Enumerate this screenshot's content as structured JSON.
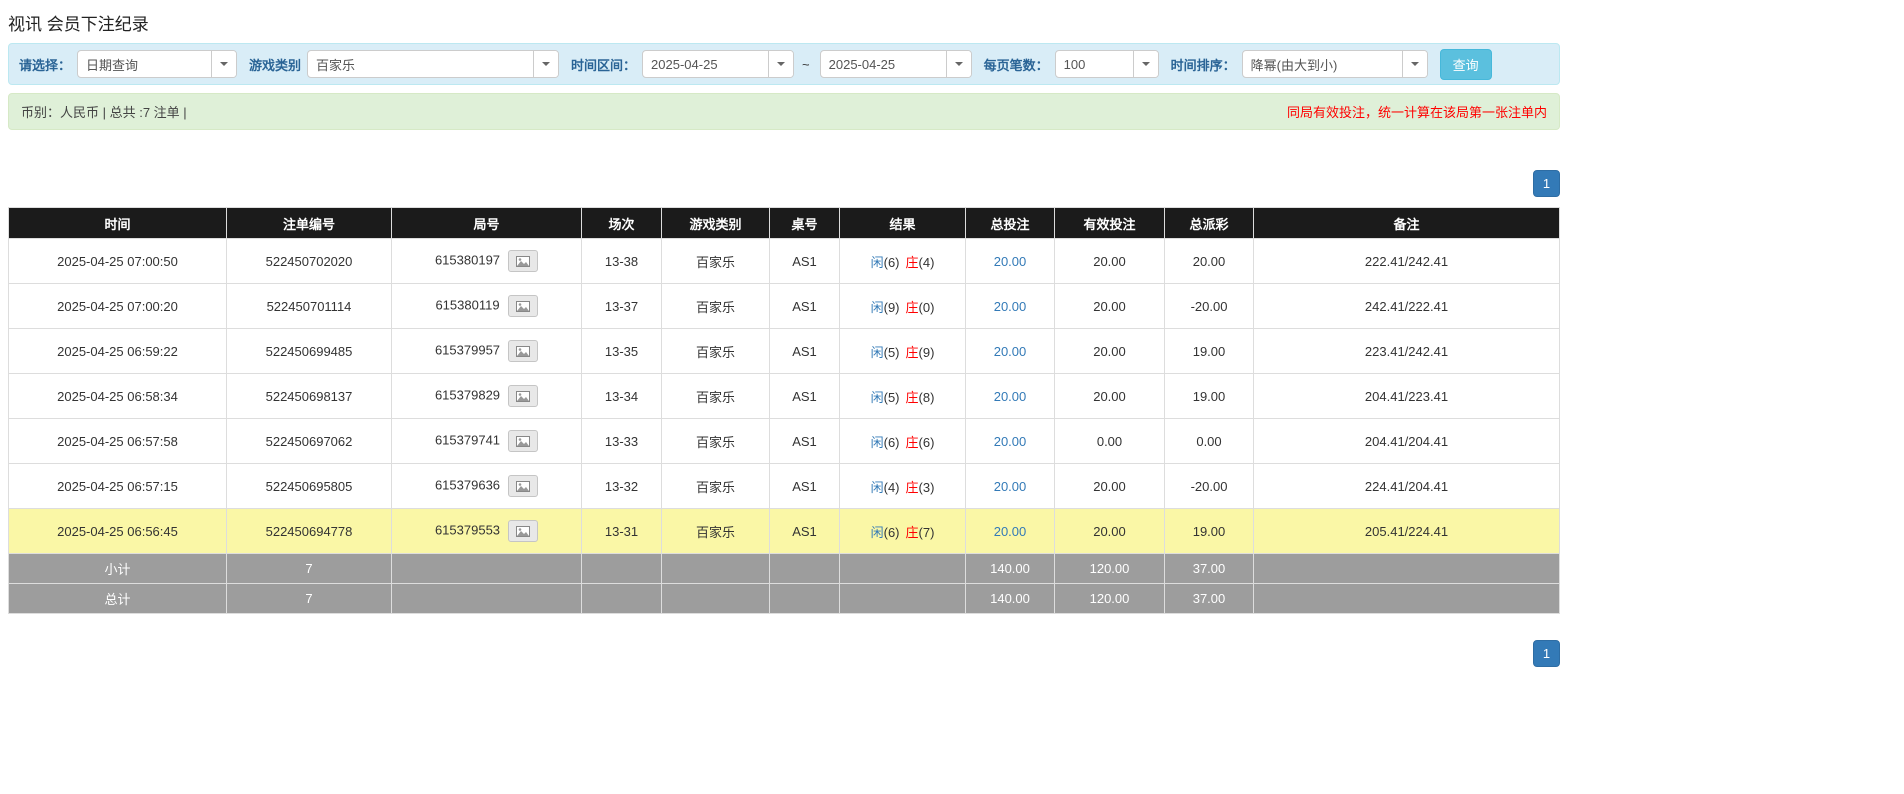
{
  "page_title": "视讯 会员下注纪录",
  "filter_bar": {
    "select_label": "请选择：",
    "select_value": "日期查询",
    "game_label": "游戏类别",
    "game_value": "百家乐",
    "range_label": "时间区间：",
    "date_from": "2025-04-25",
    "range_separator": "~",
    "date_to": "2025-04-25",
    "per_page_label": "每页笔数：",
    "per_page_value": "100",
    "sort_label": "时间排序：",
    "sort_value": "降幂(由大到小)",
    "search_button_label": "查询"
  },
  "notice_bar": {
    "summary_text": "币别：人民币 | 总共 :7 注单 |",
    "warning_text": "同局有效投注，统一计算在该局第一张注单内"
  },
  "pagination": {
    "top_page": "1",
    "bottom_page": "1"
  },
  "table": {
    "headers": [
      "时间",
      "注单编号",
      "局号",
      "场次",
      "游戏类别",
      "桌号",
      "结果",
      "总投注",
      "有效投注",
      "总派彩",
      "备注"
    ],
    "rows": [
      {
        "time": "2025-04-25 07:00:50",
        "bet_no": "522450702020",
        "round_no": "615380197",
        "session": "13-38",
        "game": "百家乐",
        "table_no": "AS1",
        "player": "闲",
        "player_score": "(6)",
        "banker": "庄",
        "banker_score": "(4)",
        "total_bet": "20.00",
        "valid_bet": "20.00",
        "payout": "20.00",
        "note": "222.41/242.41",
        "highlight": false
      },
      {
        "time": "2025-04-25 07:00:20",
        "bet_no": "522450701114",
        "round_no": "615380119",
        "session": "13-37",
        "game": "百家乐",
        "table_no": "AS1",
        "player": "闲",
        "player_score": "(9)",
        "banker": "庄",
        "banker_score": "(0)",
        "total_bet": "20.00",
        "valid_bet": "20.00",
        "payout": "-20.00",
        "note": "242.41/222.41",
        "highlight": false
      },
      {
        "time": "2025-04-25 06:59:22",
        "bet_no": "522450699485",
        "round_no": "615379957",
        "session": "13-35",
        "game": "百家乐",
        "table_no": "AS1",
        "player": "闲",
        "player_score": "(5)",
        "banker": "庄",
        "banker_score": "(9)",
        "total_bet": "20.00",
        "valid_bet": "20.00",
        "payout": "19.00",
        "note": "223.41/242.41",
        "highlight": false
      },
      {
        "time": "2025-04-25 06:58:34",
        "bet_no": "522450698137",
        "round_no": "615379829",
        "session": "13-34",
        "game": "百家乐",
        "table_no": "AS1",
        "player": "闲",
        "player_score": "(5)",
        "banker": "庄",
        "banker_score": "(8)",
        "total_bet": "20.00",
        "valid_bet": "20.00",
        "payout": "19.00",
        "note": "204.41/223.41",
        "highlight": false
      },
      {
        "time": "2025-04-25 06:57:58",
        "bet_no": "522450697062",
        "round_no": "615379741",
        "session": "13-33",
        "game": "百家乐",
        "table_no": "AS1",
        "player": "闲",
        "player_score": "(6)",
        "banker": "庄",
        "banker_score": "(6)",
        "total_bet": "20.00",
        "valid_bet": "0.00",
        "payout": "0.00",
        "note": "204.41/204.41",
        "highlight": false
      },
      {
        "time": "2025-04-25 06:57:15",
        "bet_no": "522450695805",
        "round_no": "615379636",
        "session": "13-32",
        "game": "百家乐",
        "table_no": "AS1",
        "player": "闲",
        "player_score": "(4)",
        "banker": "庄",
        "banker_score": "(3)",
        "total_bet": "20.00",
        "valid_bet": "20.00",
        "payout": "-20.00",
        "note": "224.41/204.41",
        "highlight": false
      },
      {
        "time": "2025-04-25 06:56:45",
        "bet_no": "522450694778",
        "round_no": "615379553",
        "session": "13-31",
        "game": "百家乐",
        "table_no": "AS1",
        "player": "闲",
        "player_score": "(6)",
        "banker": "庄",
        "banker_score": "(7)",
        "total_bet": "20.00",
        "valid_bet": "20.00",
        "payout": "19.00",
        "note": "205.41/224.41",
        "highlight": true
      }
    ],
    "subtotal_row": {
      "label": "小计",
      "count": "7",
      "total_bet": "140.00",
      "valid_bet": "120.00",
      "payout": "37.00"
    },
    "total_row": {
      "label": "总计",
      "count": "7",
      "total_bet": "140.00",
      "valid_bet": "120.00",
      "payout": "37.00"
    }
  },
  "colors": {
    "accent_blue": "#337ab7",
    "negative_red": "#ff0000",
    "player_blue": "#337ab7",
    "banker_red": "#ff0000",
    "highlight_yellow": "#faf7a6",
    "table_header_bg": "#1b1b1b",
    "sum_row_gray": "#9d9d9d",
    "filter_bar_bg": "#d9edf7",
    "notice_bar_bg": "#dff0d8",
    "search_button_teal": "#5bc0de"
  }
}
